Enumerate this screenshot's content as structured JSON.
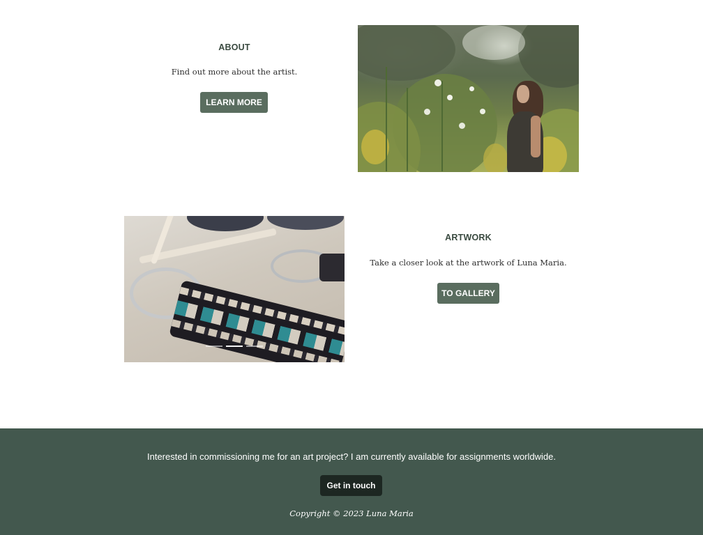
{
  "about": {
    "title": "ABOUT",
    "description": "Find out more about the artist.",
    "button_label": "LEARN MORE"
  },
  "artwork": {
    "title": "ARTWORK",
    "description": "Take a closer look at the artwork of Luna Maria.",
    "button_label": "TO GALLERY",
    "slider": {
      "slide_count": 3,
      "active_slide": 2
    }
  },
  "footer": {
    "text": "Interested in commissioning me for an art project? I am currently available for assignments worldwide.",
    "button_label": "Get in touch",
    "copyright": "Copyright © 2023 Luna Maria"
  },
  "colors": {
    "button": "#5a6d5f",
    "footer_bg": "#43584e",
    "footer_button": "#1d2722",
    "heading": "#3a4a40"
  }
}
